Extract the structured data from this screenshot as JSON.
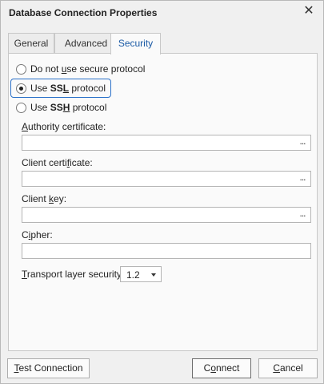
{
  "dialog": {
    "title": "Database Connection Properties",
    "close_icon": "close-icon"
  },
  "tabs": [
    {
      "label": "General"
    },
    {
      "label": "Advanced"
    },
    {
      "label": "Security",
      "selected": true
    }
  ],
  "security": {
    "protocol_options": [
      {
        "pre": "Do not ",
        "u": "u",
        "post": "se secure protocol",
        "checked": false
      },
      {
        "pre": "Use ",
        "bold": "SS",
        "bold_u": "L",
        "post": " protocol",
        "checked": true
      },
      {
        "pre": "Use ",
        "bold": "SS",
        "bold_u": "H",
        "post": " protocol",
        "checked": false
      }
    ],
    "authority_certificate": {
      "label_u": "A",
      "label_rest": "uthority certificate:",
      "value": "",
      "browse": "..."
    },
    "client_certificate": {
      "label_pre": "Client certi",
      "label_u": "f",
      "label_rest": "icate:",
      "value": "",
      "browse": "..."
    },
    "client_key": {
      "label_pre": "Client ",
      "label_u": "k",
      "label_rest": "ey:",
      "value": "",
      "browse": "..."
    },
    "cipher": {
      "label_pre": "C",
      "label_u": "i",
      "label_rest": "pher:",
      "value": ""
    },
    "tls": {
      "label_u": "T",
      "label_rest": "ransport layer security:",
      "value": "1.2"
    }
  },
  "buttons": {
    "test": {
      "u": "T",
      "rest": "est Connection"
    },
    "connect": {
      "pre": "C",
      "u": "o",
      "rest": "nnect"
    },
    "cancel": {
      "u": "C",
      "rest": "ancel"
    }
  },
  "colors": {
    "accent": "#2a70c8",
    "tab_selected_text": "#1a5aa5"
  }
}
